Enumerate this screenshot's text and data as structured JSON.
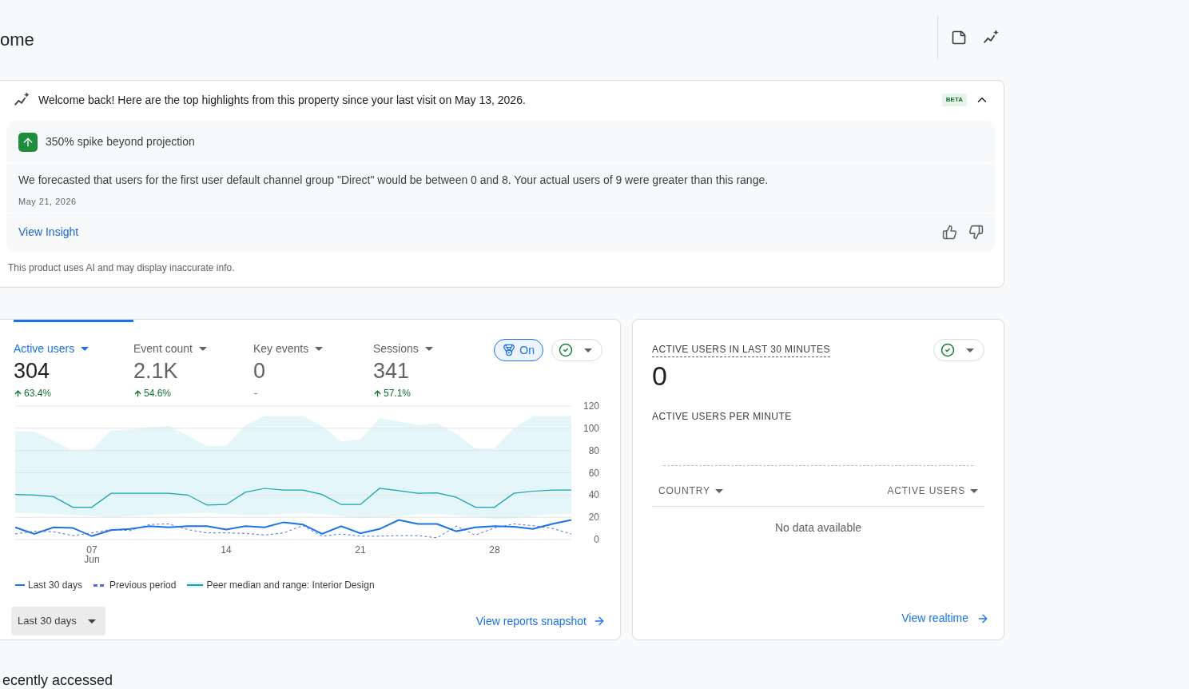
{
  "page": {
    "title": "ome"
  },
  "insights": {
    "headline": "Welcome back! Here are the top highlights from this property since your last visit on May 13, 2026.",
    "badge": "BETA",
    "expanded": true,
    "card": {
      "title": "350% spike beyond projection",
      "body": "We forecasted that users for the first user default channel group \"Direct\" would be between 0 and 8. Your actual users of 9 were greater than this range.",
      "date": "May 21, 2026",
      "link": "View Insight"
    },
    "disclaimer": "This product uses AI and may display inaccurate info."
  },
  "overview": {
    "metrics": [
      {
        "label": "Active users",
        "value": "304",
        "change": "63.4%",
        "increase": true,
        "selected": true
      },
      {
        "label": "Event count",
        "value": "2.1K",
        "change": "54.6%",
        "increase": true,
        "selected": false
      },
      {
        "label": "Key events",
        "value": "0",
        "change": "-",
        "selected": false
      },
      {
        "label": "Sessions",
        "value": "341",
        "change": "57.1%",
        "increase": true,
        "selected": false
      }
    ],
    "benchmark": {
      "label": "On",
      "on": true
    },
    "chart_data": {
      "type": "line",
      "x": [
        3,
        4,
        5,
        6,
        7,
        8,
        9,
        10,
        11,
        12,
        13,
        14,
        15,
        16,
        17,
        18,
        19,
        20,
        21,
        22,
        23,
        24,
        25,
        26,
        27,
        28,
        29,
        30,
        31,
        32
      ],
      "xlim": [
        3,
        32
      ],
      "ylim": [
        0,
        120
      ],
      "grid": true,
      "legend": true,
      "yticks": [
        0,
        20,
        40,
        60,
        80,
        100,
        120
      ],
      "xticks": [
        {
          "value": 7,
          "label": "07\nJun"
        },
        {
          "value": 14,
          "label": "14"
        },
        {
          "value": 21,
          "label": "21"
        },
        {
          "value": 28,
          "label": "28"
        }
      ],
      "series": [
        {
          "name": "Last 30 days",
          "color": "#1a73e8",
          "line_style": "solid",
          "values": [
            11,
            5,
            11,
            10.5,
            3,
            8.5,
            9.5,
            12,
            11,
            12,
            12,
            9,
            12,
            11,
            15.5,
            13.5,
            5,
            12,
            5.5,
            9.5,
            17.5,
            14,
            14,
            7.5,
            11,
            12,
            11.5,
            9.5,
            14,
            17.5
          ]
        },
        {
          "name": "Previous period",
          "color": "#4c6fdb",
          "line_style": "dashed",
          "values": [
            5,
            7.5,
            7,
            3.5,
            6,
            9,
            8,
            13.5,
            14,
            9,
            6,
            6,
            5.5,
            4,
            6,
            12.5,
            3,
            5,
            3,
            3,
            3.5,
            3.5,
            1.5,
            12,
            4,
            10.5,
            14,
            12.5,
            10,
            5
          ]
        },
        {
          "name": "Peer median and range: Interior Design",
          "color": "#12a4af",
          "line_style": "solid",
          "values": [
            40.5,
            40,
            38.5,
            29,
            29,
            41.5,
            41.5,
            41.5,
            41.5,
            40,
            31,
            31.5,
            42.5,
            46,
            44.5,
            44.5,
            40.5,
            31.5,
            31.5,
            46,
            44,
            41.5,
            42,
            38,
            29,
            29,
            41.5,
            43.5,
            44.5,
            44.5
          ]
        }
      ]
    },
    "date_range": "Last 30 days",
    "link": "View reports snapshot"
  },
  "realtime": {
    "title": "ACTIVE USERS IN LAST 30 MINUTES",
    "value": "0",
    "subtitle": "ACTIVE USERS PER MINUTE",
    "columns": [
      "COUNTRY",
      "ACTIVE USERS"
    ],
    "empty": "No data available",
    "link": "View realtime"
  },
  "recent": {
    "title": "ecently accessed"
  }
}
